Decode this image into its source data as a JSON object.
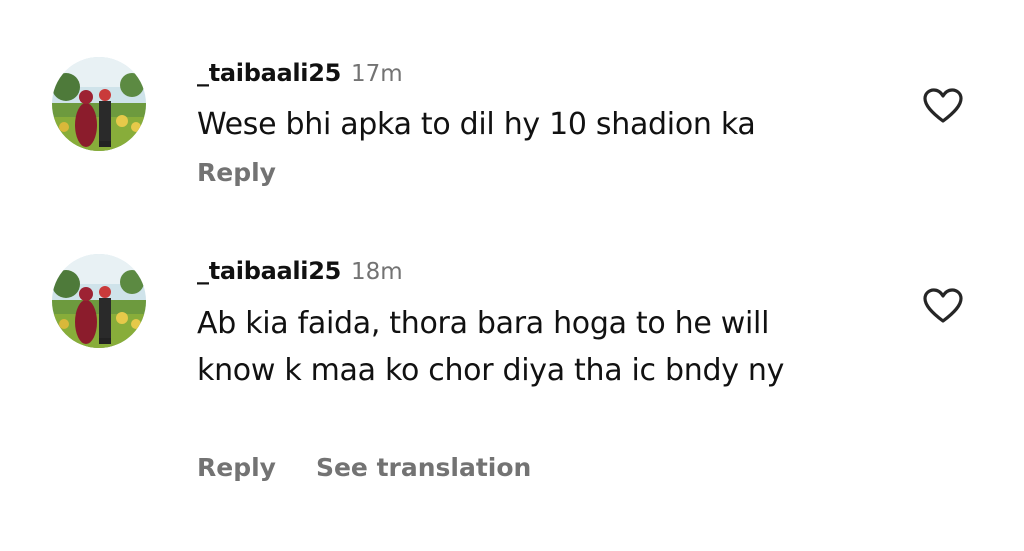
{
  "comments": [
    {
      "username": "_taibaali25",
      "time": "17m",
      "text": "Wese bhi apka to dil hy 10 shadion ka",
      "actions": {
        "reply": "Reply"
      },
      "avatar_icon": "profile-photo",
      "like_icon": "heart-outline-icon"
    },
    {
      "username": "_taibaali25",
      "time": "18m",
      "text": "Ab kia faida, thora bara hoga to he will know k maa ko chor diya tha ic bndy ny",
      "actions": {
        "reply": "Reply",
        "see_translation": "See translation"
      },
      "avatar_icon": "profile-photo",
      "like_icon": "heart-outline-icon"
    }
  ],
  "colors": {
    "primary_text": "#111111",
    "secondary_text": "#737373",
    "background": "#ffffff"
  }
}
